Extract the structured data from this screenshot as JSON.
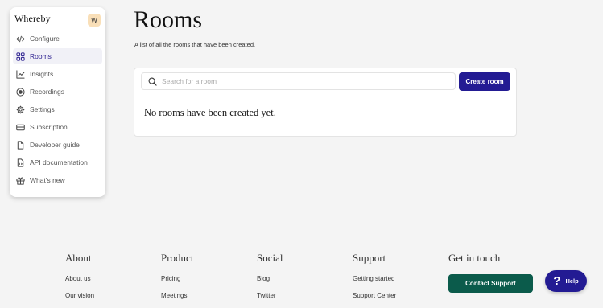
{
  "sidebar": {
    "logo": "Whereby",
    "avatar": "W",
    "items": [
      {
        "label": "Configure",
        "icon": "code-icon"
      },
      {
        "label": "Rooms",
        "icon": "rooms-grid-icon",
        "active": true
      },
      {
        "label": "Insights",
        "icon": "chart-line-icon"
      },
      {
        "label": "Recordings",
        "icon": "record-icon"
      },
      {
        "label": "Settings",
        "icon": "gear-icon"
      },
      {
        "label": "Subscription",
        "icon": "card-icon"
      },
      {
        "label": "Developer guide",
        "icon": "document-icon"
      },
      {
        "label": "API documentation",
        "icon": "api-doc-icon"
      },
      {
        "label": "What's new",
        "icon": "gift-icon"
      }
    ]
  },
  "main": {
    "title": "Rooms",
    "subtitle": "A list of all the rooms that have been created.",
    "search": {
      "placeholder": "Search for a room",
      "value": ""
    },
    "create_button": "Create room",
    "empty_message": "No rooms have been created yet."
  },
  "footer": {
    "about": {
      "heading": "About",
      "links": [
        "About us",
        "Our vision"
      ]
    },
    "product": {
      "heading": "Product",
      "links": [
        "Pricing",
        "Meetings"
      ]
    },
    "social": {
      "heading": "Social",
      "links": [
        "Blog",
        "Twitter"
      ]
    },
    "support": {
      "heading": "Support",
      "links": [
        "Getting started",
        "Support Center"
      ]
    },
    "contact": {
      "heading": "Get in touch",
      "button": "Contact Support"
    }
  },
  "help": {
    "icon": "?",
    "label": "Help"
  },
  "colors": {
    "primary": "#231b93",
    "contact": "#0b5b4b",
    "avatar_bg": "#f9dfb8"
  }
}
